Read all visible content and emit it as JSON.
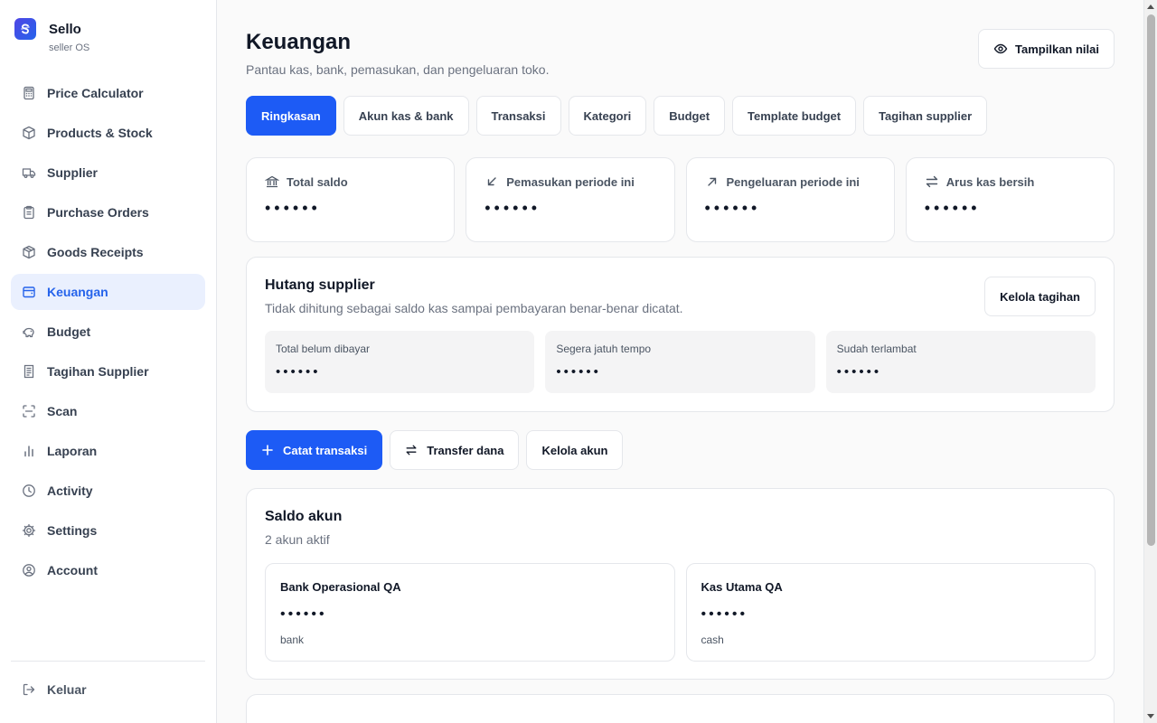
{
  "brand": {
    "name": "Sello",
    "tagline": "seller OS"
  },
  "sidebar": {
    "items": [
      {
        "label": "Price Calculator",
        "icon": "calculator-icon",
        "active": false
      },
      {
        "label": "Products & Stock",
        "icon": "box-icon",
        "active": false
      },
      {
        "label": "Supplier",
        "icon": "truck-icon",
        "active": false
      },
      {
        "label": "Purchase Orders",
        "icon": "clipboard-icon",
        "active": false
      },
      {
        "label": "Goods Receipts",
        "icon": "package-icon",
        "active": false
      },
      {
        "label": "Keuangan",
        "icon": "wallet-icon",
        "active": true
      },
      {
        "label": "Budget",
        "icon": "piggy-bank-icon",
        "active": false
      },
      {
        "label": "Tagihan Supplier",
        "icon": "receipt-icon",
        "active": false
      },
      {
        "label": "Scan",
        "icon": "scan-icon",
        "active": false
      },
      {
        "label": "Laporan",
        "icon": "bar-chart-icon",
        "active": false
      },
      {
        "label": "Activity",
        "icon": "clock-icon",
        "active": false
      },
      {
        "label": "Settings",
        "icon": "gear-icon",
        "active": false
      },
      {
        "label": "Account",
        "icon": "user-circle-icon",
        "active": false
      }
    ],
    "logout_label": "Keluar"
  },
  "header": {
    "title": "Keuangan",
    "subtitle": "Pantau kas, bank, pemasukan, dan pengeluaran toko.",
    "toggle_label": "Tampilkan nilai"
  },
  "tabs": [
    {
      "label": "Ringkasan",
      "active": true
    },
    {
      "label": "Akun kas & bank",
      "active": false
    },
    {
      "label": "Transaksi",
      "active": false
    },
    {
      "label": "Kategori",
      "active": false
    },
    {
      "label": "Budget",
      "active": false
    },
    {
      "label": "Template budget",
      "active": false
    },
    {
      "label": "Tagihan supplier",
      "active": false
    }
  ],
  "stats": [
    {
      "label": "Total saldo",
      "value": "••••••",
      "icon": "bank-icon"
    },
    {
      "label": "Pemasukan periode ini",
      "value": "••••••",
      "icon": "arrow-down-left-icon"
    },
    {
      "label": "Pengeluaran periode ini",
      "value": "••••••",
      "icon": "arrow-up-right-icon"
    },
    {
      "label": "Arus kas bersih",
      "value": "••••••",
      "icon": "swap-icon"
    }
  ],
  "hutang": {
    "title": "Hutang supplier",
    "subtitle": "Tidak dihitung sebagai saldo kas sampai pembayaran benar-benar dicatat.",
    "manage_label": "Kelola tagihan",
    "items": [
      {
        "label": "Total belum dibayar",
        "value": "••••••"
      },
      {
        "label": "Segera jatuh tempo",
        "value": "••••••"
      },
      {
        "label": "Sudah terlambat",
        "value": "••••••"
      }
    ]
  },
  "actions": {
    "record_label": "Catat transaksi",
    "transfer_label": "Transfer dana",
    "manage_accounts_label": "Kelola akun"
  },
  "saldo": {
    "title": "Saldo akun",
    "subtitle": "2 akun aktif",
    "accounts": [
      {
        "name": "Bank Operasional QA",
        "value": "••••••",
        "type": "bank"
      },
      {
        "name": "Kas Utama QA",
        "value": "••••••",
        "type": "cash"
      }
    ]
  },
  "colors": {
    "accent": "#1d5bf5",
    "active_bg": "#eaf0fe",
    "active_text": "#2563eb"
  }
}
